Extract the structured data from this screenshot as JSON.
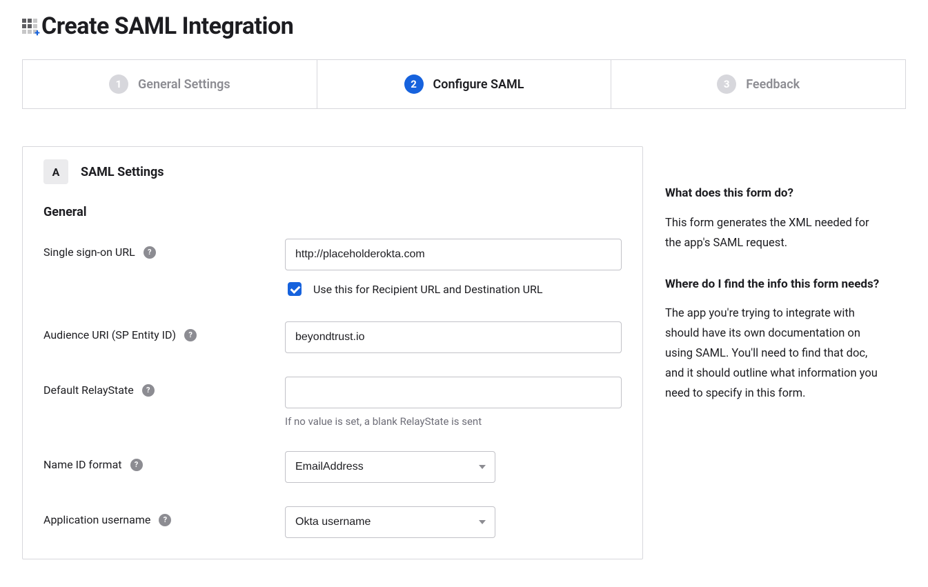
{
  "page_title": "Create SAML Integration",
  "stepper": {
    "steps": [
      {
        "n": "1",
        "label": "General Settings",
        "active": false
      },
      {
        "n": "2",
        "label": "Configure SAML",
        "active": true
      },
      {
        "n": "3",
        "label": "Feedback",
        "active": false
      }
    ]
  },
  "card": {
    "letter": "A",
    "title": "SAML Settings",
    "section": "General"
  },
  "fields": {
    "sso_url": {
      "label": "Single sign-on URL",
      "value": "http://placeholderokta.com",
      "checkbox_label": "Use this for Recipient URL and Destination URL",
      "checkbox_checked": true
    },
    "audience": {
      "label": "Audience URI (SP Entity ID)",
      "value": "beyondtrust.io"
    },
    "relay": {
      "label": "Default RelayState",
      "value": "",
      "hint": "If no value is set, a blank RelayState is sent"
    },
    "nameid": {
      "label": "Name ID format",
      "value": "EmailAddress"
    },
    "appuser": {
      "label": "Application username",
      "value": "Okta username"
    }
  },
  "help": {
    "q1": "What does this form do?",
    "a1": "This form generates the XML needed for the app's SAML request.",
    "q2": "Where do I find the info this form needs?",
    "a2": "The app you're trying to integrate with should have its own documentation on using SAML. You'll need to find that doc, and it should outline what information you need to specify in this form."
  }
}
